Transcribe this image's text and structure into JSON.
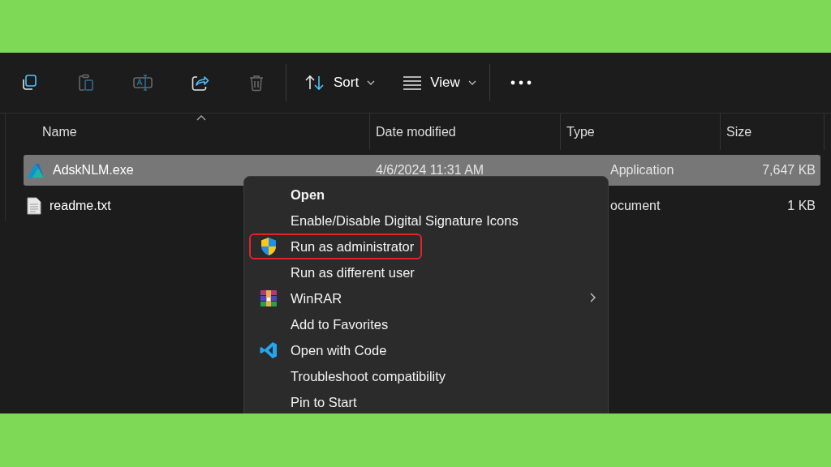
{
  "toolbar": {
    "actions": [
      {
        "kind": "copy",
        "disabled": false
      },
      {
        "kind": "paste",
        "disabled": true
      },
      {
        "kind": "rename",
        "disabled": true
      },
      {
        "kind": "share",
        "disabled": false
      },
      {
        "kind": "delete",
        "disabled": true
      }
    ],
    "sort": {
      "label": "Sort"
    },
    "view": {
      "label": "View"
    }
  },
  "table": {
    "columns": [
      {
        "label": "Name",
        "sorted": true
      },
      {
        "label": "Date modified",
        "sorted": false
      },
      {
        "label": "Type",
        "sorted": false
      },
      {
        "label": "Size",
        "sorted": false
      }
    ],
    "rows": [
      {
        "kind": "app",
        "name": "AdskNLM.exe",
        "date": "4/6/2024 11:31 AM",
        "type": "Application",
        "size": "7,647 KB",
        "selected": true
      },
      {
        "kind": "text",
        "name": "readme.txt",
        "date": "",
        "type": "ocument",
        "size": "1 KB",
        "selected": false
      }
    ]
  },
  "context_menu": {
    "items": [
      {
        "kind": "plain",
        "label": "Open",
        "bold": true,
        "highlighted": false,
        "submenu": false
      },
      {
        "kind": "plain",
        "label": "Enable/Disable Digital Signature Icons",
        "bold": false,
        "highlighted": false,
        "submenu": false
      },
      {
        "kind": "shield",
        "label": "Run as administrator",
        "bold": false,
        "highlighted": true,
        "submenu": false
      },
      {
        "kind": "plain",
        "label": "Run as different user",
        "bold": false,
        "highlighted": false,
        "submenu": false
      },
      {
        "kind": "archive",
        "label": "WinRAR",
        "bold": false,
        "highlighted": false,
        "submenu": true
      },
      {
        "kind": "plain",
        "label": "Add to Favorites",
        "bold": false,
        "highlighted": false,
        "submenu": false
      },
      {
        "kind": "code",
        "label": "Open with Code",
        "bold": false,
        "highlighted": false,
        "submenu": false
      },
      {
        "kind": "plain",
        "label": "Troubleshoot compatibility",
        "bold": false,
        "highlighted": false,
        "submenu": false
      },
      {
        "kind": "plain",
        "label": "Pin to Start",
        "bold": false,
        "highlighted": false,
        "submenu": false
      }
    ]
  }
}
